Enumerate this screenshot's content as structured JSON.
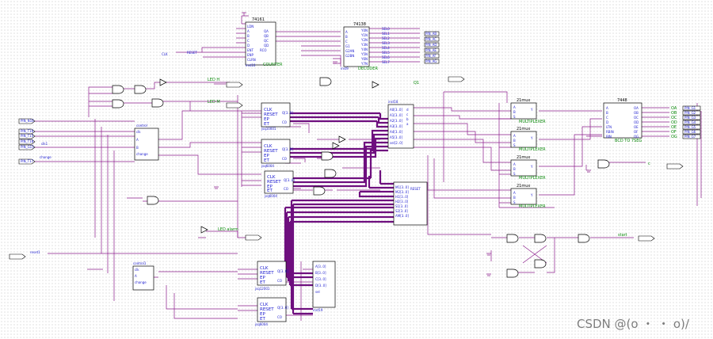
{
  "chips": {
    "counter_top": {
      "part": "74161",
      "type": "COUNTER",
      "inst": "inst10"
    },
    "decoder": {
      "part": "74138",
      "type": "DECODER",
      "inst": "inst9"
    },
    "mux1": {
      "part": "21mux",
      "type": "MULTIPLEXER"
    },
    "mux2": {
      "part": "21mux",
      "type": "MULTIPLEXER"
    },
    "mux3": {
      "part": "21mux",
      "type": "MULTIPLEXER"
    },
    "mux4": {
      "part": "21mux",
      "type": "MULTIPLEXER"
    },
    "seg7": {
      "part": "7448",
      "type": "BCD TO 7SEG"
    },
    "cnt10a": {
      "name": "jsq10001"
    },
    "cnt10b": {
      "name": "jsq6004"
    },
    "cnt6": {
      "name": "jsq6004"
    },
    "ctrl1": {
      "name": "control"
    },
    "ctrl2": {
      "name": "control1"
    },
    "cnt12": {
      "name": "jsq12001"
    },
    "cnt60": {
      "name": "jsq6004"
    },
    "mid_block": {
      "name": "inst18"
    },
    "cmp_block": {
      "label": "RESET"
    },
    "bot_block": {
      "name": "inst19"
    }
  },
  "labels": {
    "led_h": "LED H",
    "led_m": "LED M",
    "led_alarm": "LED alarm",
    "q1_out": "Q1",
    "clk": "CLK",
    "reset": "RESET",
    "start": "start",
    "c": "c",
    "clk1": "clk1",
    "change": "change",
    "reset1": "reset1"
  },
  "pins": {
    "in_left": [
      "PIN_N16",
      "PIN_T16",
      "PIN_T15",
      "PIN_T18",
      "PIN_G15",
      "PIN_T17"
    ],
    "out_right_seg": [
      "PIN_G1",
      "PIN_G2",
      "PIN_G3",
      "PIN_G4",
      "PIN_G5",
      "PIN_G6",
      "PIN_G7"
    ],
    "decoder_out": [
      "PIN_AB",
      "PIN_AC",
      "PIN_AD",
      "PIN_AE",
      "PIN_AF",
      "PIN_AG",
      "PIN_AH",
      "PIN_AI"
    ]
  },
  "seg_outputs": [
    "OA",
    "OB",
    "OC",
    "OD",
    "OE",
    "OF",
    "OG"
  ],
  "dec_outputs": [
    "SEL0",
    "SEL1",
    "SEL2",
    "SEL3",
    "SEL4",
    "SEL5",
    "SEL6",
    "SEL7"
  ],
  "watermark": "CSDN @(o ・ ・ o)/"
}
